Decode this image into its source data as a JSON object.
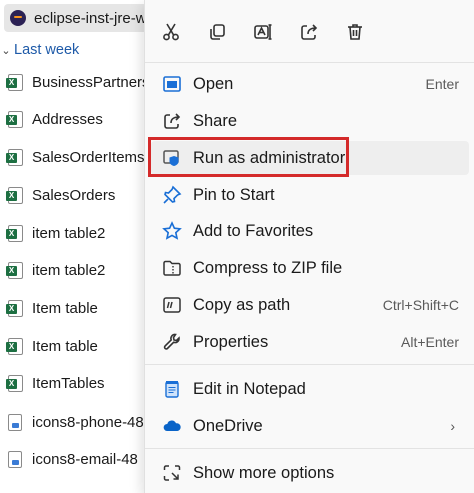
{
  "file_list": {
    "top_file": {
      "name": "eclipse-inst-jre-wi",
      "icon": "eclipse-icon"
    },
    "group_header": "Last week",
    "files": [
      {
        "name": "BusinessPartners",
        "icon": "excel-icon"
      },
      {
        "name": "Addresses",
        "icon": "excel-icon"
      },
      {
        "name": "SalesOrderItems",
        "icon": "excel-icon"
      },
      {
        "name": "SalesOrders",
        "icon": "excel-icon"
      },
      {
        "name": "item table2",
        "icon": "excel-icon"
      },
      {
        "name": "item table2",
        "icon": "excel-icon"
      },
      {
        "name": "Item table",
        "icon": "excel-icon"
      },
      {
        "name": "Item table",
        "icon": "excel-icon"
      },
      {
        "name": "ItemTables",
        "icon": "excel-icon"
      },
      {
        "name": "icons8-phone-48",
        "icon": "image-file-icon"
      },
      {
        "name": "icons8-email-48",
        "icon": "image-file-icon"
      }
    ]
  },
  "context_menu": {
    "quick_actions": [
      {
        "id": "cut",
        "icon": "scissors-icon"
      },
      {
        "id": "copy",
        "icon": "copy-icon"
      },
      {
        "id": "rename",
        "icon": "rename-icon"
      },
      {
        "id": "share",
        "icon": "share-icon"
      },
      {
        "id": "delete",
        "icon": "trash-icon"
      }
    ],
    "items": [
      {
        "id": "open",
        "label": "Open",
        "shortcut": "Enter",
        "icon": "open-window-icon"
      },
      {
        "id": "share",
        "label": "Share",
        "shortcut": "",
        "icon": "share-icon"
      },
      {
        "id": "run-as-admin",
        "label": "Run as administrator",
        "shortcut": "",
        "icon": "shield-icon"
      },
      {
        "id": "pin-to-start",
        "label": "Pin to Start",
        "shortcut": "",
        "icon": "pin-icon"
      },
      {
        "id": "add-to-favorites",
        "label": "Add to Favorites",
        "shortcut": "",
        "icon": "star-icon"
      },
      {
        "id": "compress-zip",
        "label": "Compress to ZIP file",
        "shortcut": "",
        "icon": "zip-folder-icon"
      },
      {
        "id": "copy-as-path",
        "label": "Copy as path",
        "shortcut": "Ctrl+Shift+C",
        "icon": "copy-path-icon"
      },
      {
        "id": "properties",
        "label": "Properties",
        "shortcut": "Alt+Enter",
        "icon": "wrench-icon"
      },
      {
        "id": "edit-notepad",
        "label": "Edit in Notepad",
        "shortcut": "",
        "icon": "notepad-icon"
      },
      {
        "id": "onedrive",
        "label": "OneDrive",
        "shortcut": "",
        "icon": "cloud-icon",
        "submenu_arrow": "›"
      },
      {
        "id": "show-more",
        "label": "Show more options",
        "shortcut": "",
        "icon": "more-options-icon"
      }
    ]
  },
  "colors": {
    "highlight_border": "#d42a2a",
    "accent_blue": "#1a6fd6",
    "excel_green": "#1d6f42"
  }
}
